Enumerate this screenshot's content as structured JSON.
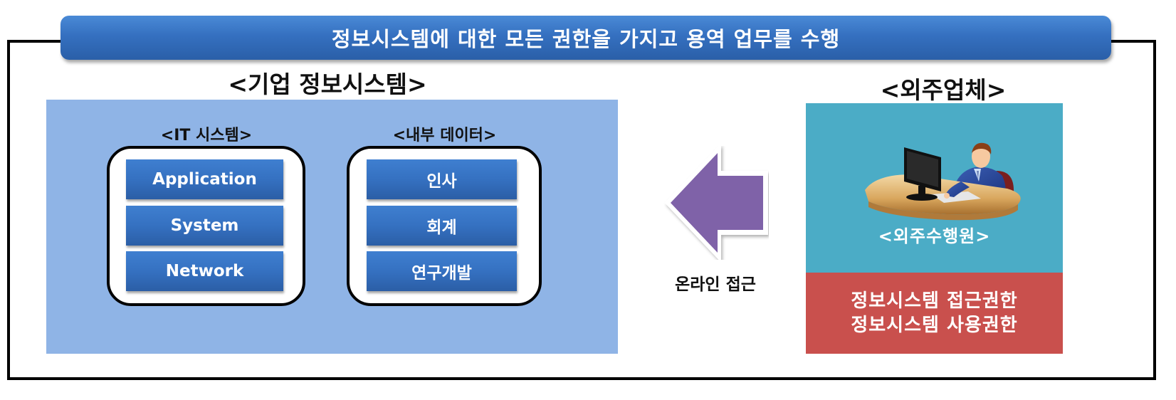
{
  "banner": {
    "text": "정보시스템에 대한 모든 권한을 가지고 용역 업무를 수행"
  },
  "enterprise": {
    "title": "<기업 정보시스템>",
    "it_system": {
      "title": "<IT 시스템>",
      "items": [
        "Application",
        "System",
        "Network"
      ]
    },
    "internal_data": {
      "title": "<내부 데이터>",
      "items": [
        "인사",
        "회계",
        "연구개발"
      ]
    }
  },
  "access": {
    "label": "온라인 접근",
    "direction": "left"
  },
  "vendor": {
    "title": "<외주업체>",
    "worker_label": "<외주수행원>",
    "worker_icon": "person-at-computer-desk-icon",
    "permissions": [
      "정보시스템 접근권한",
      "정보시스템 사용권한"
    ]
  },
  "colors": {
    "banner": "#3570c0",
    "enterprise_panel": "#8fb4e6",
    "item_button": "#3571c1",
    "arrow": "#7f62a8",
    "vendor_panel": "#4bacc6",
    "permission_panel": "#c9504d"
  }
}
